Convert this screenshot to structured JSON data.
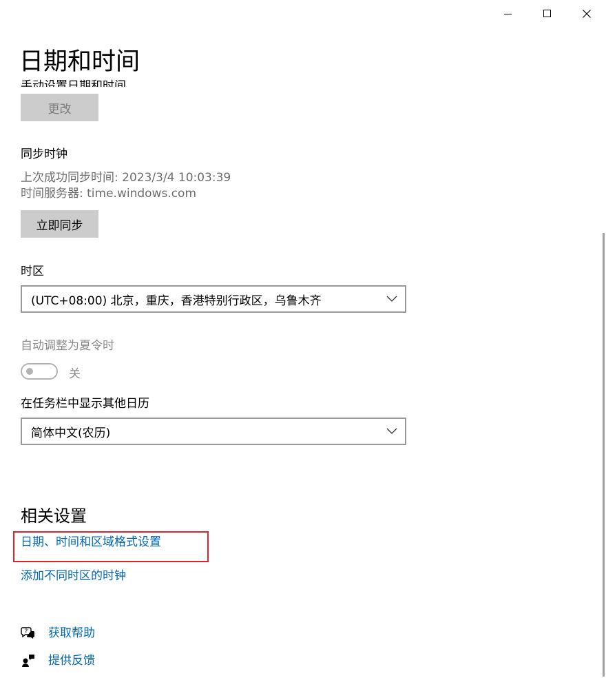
{
  "window": {
    "title": "日期和时间",
    "controls": [
      "minimize-icon",
      "maximize-icon",
      "close-icon"
    ]
  },
  "manual_set": {
    "label_partial": "手动设置日期和时间",
    "button_label": "更改"
  },
  "sync": {
    "heading": "同步时钟",
    "last_sync": "上次成功同步时间: 2023/3/4 10:03:39",
    "server": "时间服务器: time.windows.com",
    "button_label": "立即同步"
  },
  "timezone": {
    "label": "时区",
    "selected": "(UTC+08:00) 北京，重庆，香港特别行政区，乌鲁木齐"
  },
  "dst": {
    "label": "自动调整为夏令时",
    "state_label": "关",
    "on": false
  },
  "calendar": {
    "label": "在任务栏中显示其他日历",
    "selected": "简体中文(农历)"
  },
  "related": {
    "heading": "相关设置",
    "links": [
      "日期、时间和区域格式设置",
      "添加不同时区的时钟"
    ]
  },
  "help": {
    "get_help": "获取帮助",
    "feedback": "提供反馈"
  },
  "colors": {
    "link": "#0066b4",
    "highlight": "#e0202a"
  }
}
